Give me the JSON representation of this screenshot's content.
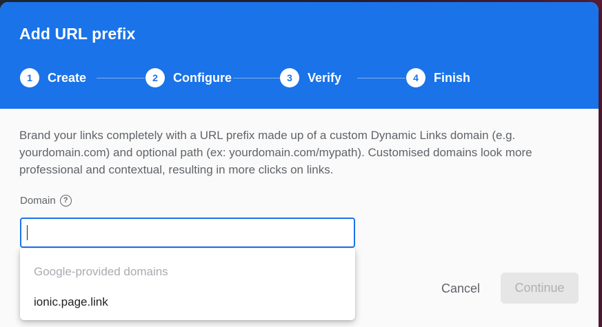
{
  "dialog": {
    "title": "Add URL prefix",
    "steps": [
      {
        "number": "1",
        "label": "Create",
        "state": "active"
      },
      {
        "number": "2",
        "label": "Configure",
        "state": "pending"
      },
      {
        "number": "3",
        "label": "Verify",
        "state": "pending"
      },
      {
        "number": "4",
        "label": "Finish",
        "state": "pending"
      }
    ],
    "description": "Brand your links completely with a URL prefix made up of a custom Dynamic Links domain (e.g. yourdomain.com) and optional path (ex: yourdomain.com/mypath). Customised domains look more professional and contextual, resulting in more clicks on links.",
    "domain_label": "Domain",
    "help_icon": "?",
    "domain_input": {
      "value": "",
      "placeholder": ""
    },
    "dropdown": {
      "header": "Google-provided domains",
      "options": [
        "ionic.page.link"
      ]
    },
    "cancel_label": "Cancel",
    "continue_label": "Continue"
  },
  "colors": {
    "header_bg": "#1a73e8",
    "accent": "#1a73e8",
    "disabled_button_bg": "#e6e6e6"
  },
  "icons": {
    "help": "help-circle-icon"
  }
}
